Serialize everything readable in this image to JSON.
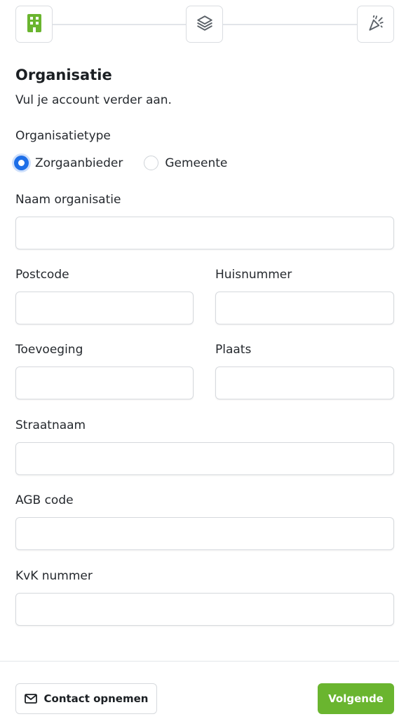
{
  "stepper": {
    "steps": [
      {
        "icon": "building-icon",
        "active": true
      },
      {
        "icon": "layers-icon",
        "active": false
      },
      {
        "icon": "party-popper-icon",
        "active": false
      }
    ],
    "accent_color": "#6ab52f"
  },
  "form": {
    "title": "Organisatie",
    "subtitle": "Vul je account verder aan.",
    "org_type": {
      "label": "Organisatietype",
      "options": [
        "Zorgaanbieder",
        "Gemeente"
      ],
      "selected": "Zorgaanbieder"
    },
    "fields": {
      "naam": {
        "label": "Naam organisatie",
        "value": ""
      },
      "postcode": {
        "label": "Postcode",
        "value": ""
      },
      "huisnummer": {
        "label": "Huisnummer",
        "value": ""
      },
      "toevoeging": {
        "label": "Toevoeging",
        "value": ""
      },
      "plaats": {
        "label": "Plaats",
        "value": ""
      },
      "straatnaam": {
        "label": "Straatnaam",
        "value": ""
      },
      "agb": {
        "label": "AGB code",
        "value": ""
      },
      "kvk": {
        "label": "KvK nummer",
        "value": ""
      }
    }
  },
  "footer": {
    "contact_label": "Contact opnemen",
    "contact_icon": "mail-icon",
    "next_label": "Volgende",
    "next_color": "#6ab52f",
    "radio_color": "#1e6fe8"
  }
}
